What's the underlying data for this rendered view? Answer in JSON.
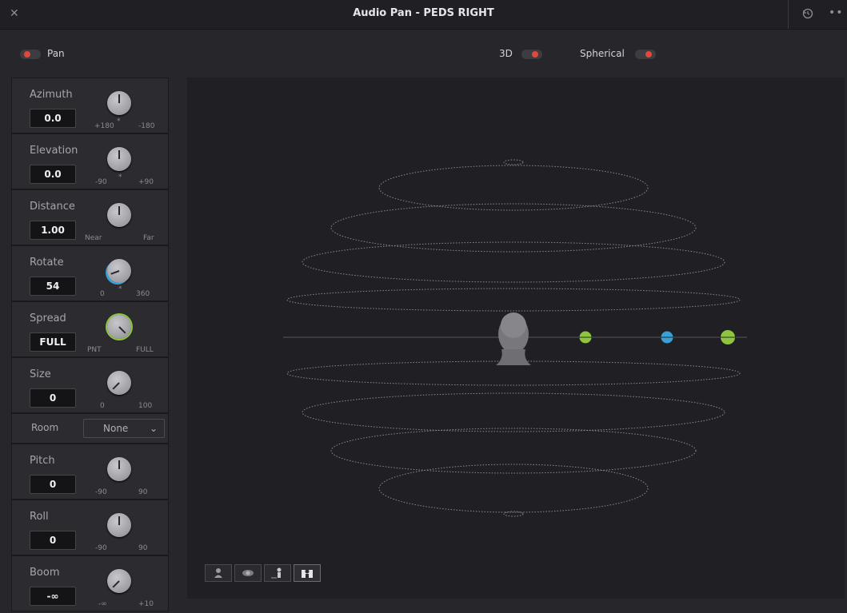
{
  "window": {
    "title": "Audio Pan - PEDS RIGHT",
    "close_icon": "close-icon",
    "reset_icon": "reset-icon",
    "more_icon": "more-icon"
  },
  "toggles": {
    "pan": {
      "label": "Pan",
      "on": true
    },
    "three_d": {
      "label": "3D",
      "on": true
    },
    "spherical": {
      "label": "Spherical",
      "on": true
    }
  },
  "params": [
    {
      "name": "Azimuth",
      "value": "0.0",
      "left": "+180",
      "mid": "*",
      "right": "-180"
    },
    {
      "name": "Elevation",
      "value": "0.0",
      "left": "-90",
      "mid": "*",
      "right": "+90"
    },
    {
      "name": "Distance",
      "value": "1.00",
      "left": "Near",
      "mid": "",
      "right": "Far"
    },
    {
      "name": "Rotate",
      "value": "54",
      "left": "0",
      "mid": "*",
      "right": "360"
    },
    {
      "name": "Spread",
      "value": "FULL",
      "left": "PNT",
      "mid": "",
      "right": "FULL"
    },
    {
      "name": "Size",
      "value": "0",
      "left": "0",
      "mid": "",
      "right": "100"
    }
  ],
  "room": {
    "label": "Room",
    "selected": "None"
  },
  "params2": [
    {
      "name": "Pitch",
      "value": "0",
      "left": "-90",
      "right": "90"
    },
    {
      "name": "Roll",
      "value": "0",
      "left": "-90",
      "right": "90"
    },
    {
      "name": "Boom",
      "value": "-∞",
      "left": "-∞",
      "right": "+10"
    }
  ],
  "colors": {
    "toggle_on": "#e0483c",
    "accent_green": "#8fc53e",
    "accent_blue": "#3aa0d8"
  },
  "view_buttons": [
    "perspective-view-icon",
    "top-view-icon",
    "side-view-icon",
    "front-view-icon"
  ]
}
